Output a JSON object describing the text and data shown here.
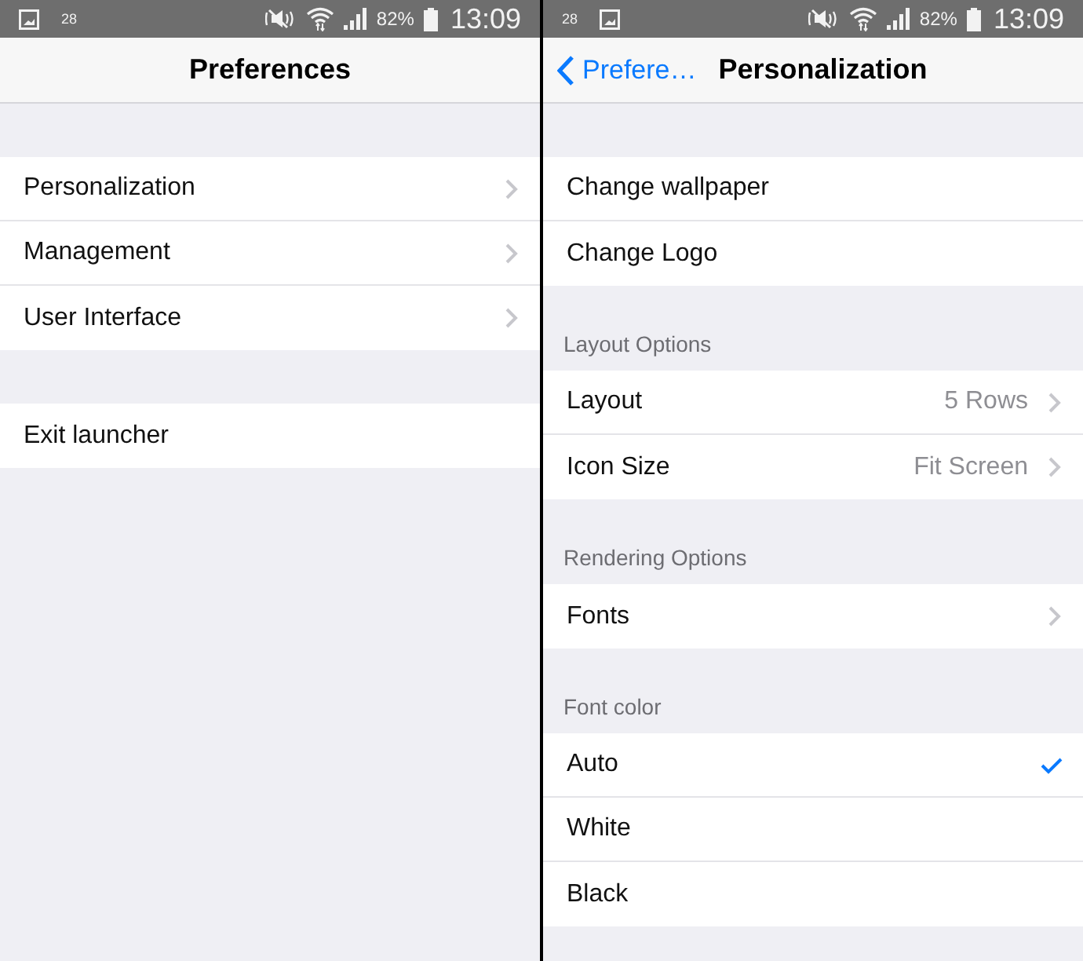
{
  "screens": [
    {
      "status_bar": {
        "left_items": [
          {
            "kind": "picture"
          },
          {
            "kind": "count",
            "text": "28"
          }
        ],
        "battery": "82%",
        "time": "13:09"
      },
      "nav": {
        "title": "Preferences"
      },
      "groups": [
        {
          "rows": [
            {
              "kind": "link",
              "label": "Personalization"
            },
            {
              "kind": "link",
              "label": "Management"
            },
            {
              "kind": "link",
              "label": "User Interface"
            }
          ]
        },
        {
          "rows": [
            {
              "kind": "action",
              "label": "Exit launcher"
            }
          ]
        }
      ]
    },
    {
      "status_bar": {
        "left_items": [
          {
            "kind": "count",
            "text": "28"
          },
          {
            "kind": "picture"
          }
        ],
        "battery": "82%",
        "time": "13:09"
      },
      "nav": {
        "back": "Prefere…",
        "title": "Personalization"
      },
      "groups": [
        {
          "rows": [
            {
              "kind": "action",
              "label": "Change wallpaper"
            },
            {
              "kind": "action",
              "label": "Change Logo"
            }
          ]
        },
        {
          "header": "Layout Options",
          "rows": [
            {
              "kind": "link",
              "label": "Layout",
              "value": "5 Rows"
            },
            {
              "kind": "link",
              "label": "Icon Size",
              "value": "Fit Screen"
            }
          ]
        },
        {
          "header": "Rendering Options",
          "rows": [
            {
              "kind": "link",
              "label": "Fonts"
            }
          ]
        },
        {
          "header": "Font color",
          "rows": [
            {
              "kind": "option",
              "label": "Auto",
              "selected": true
            },
            {
              "kind": "option",
              "label": "White",
              "selected": false
            },
            {
              "kind": "option",
              "label": "Black",
              "selected": false
            }
          ]
        }
      ]
    }
  ]
}
